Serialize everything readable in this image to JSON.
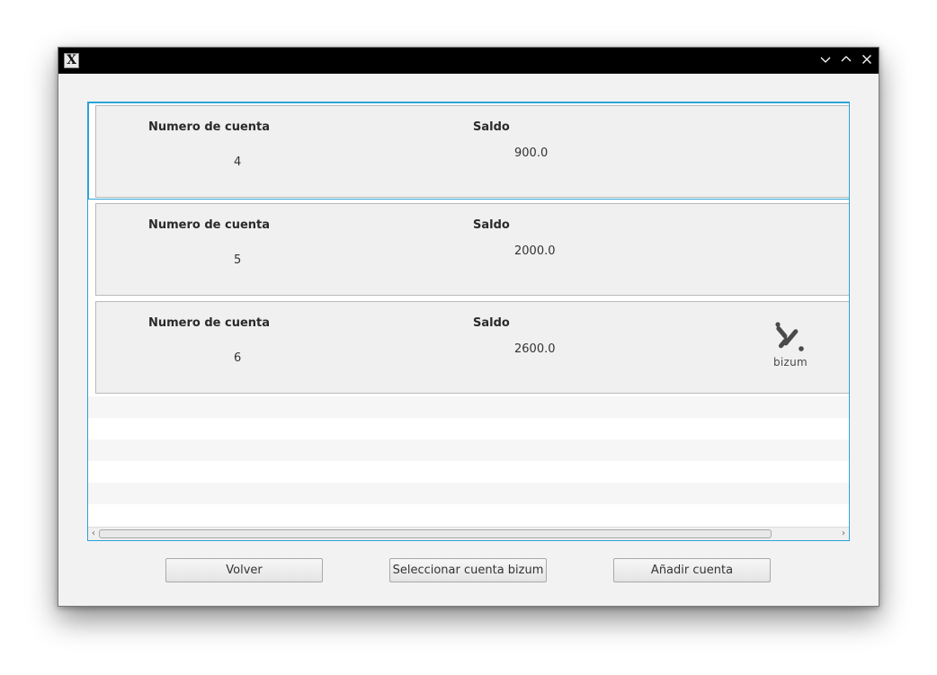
{
  "window": {
    "icon_glyph": "X",
    "controls": [
      "minimize-icon",
      "maximize-icon",
      "close-icon"
    ]
  },
  "accounts": [
    {
      "header_account": "Numero de cuenta",
      "header_balance": "Saldo",
      "account_number": "4",
      "balance": "900.0",
      "bizum": false
    },
    {
      "header_account": "Numero de cuenta",
      "header_balance": "Saldo",
      "account_number": "5",
      "balance": "2000.0",
      "bizum": false
    },
    {
      "header_account": "Numero de cuenta",
      "header_balance": "Saldo",
      "account_number": "6",
      "balance": "2600.0",
      "bizum": true,
      "bizum_label": "bizum"
    }
  ],
  "buttons": {
    "back": "Volver",
    "select_bizum": "Seleccionar cuenta bizum",
    "add_account": "Añadir cuenta"
  },
  "colors": {
    "accent": "#2ba3d6",
    "titlebar": "#000000",
    "card_bg": "#f0f0f0"
  }
}
